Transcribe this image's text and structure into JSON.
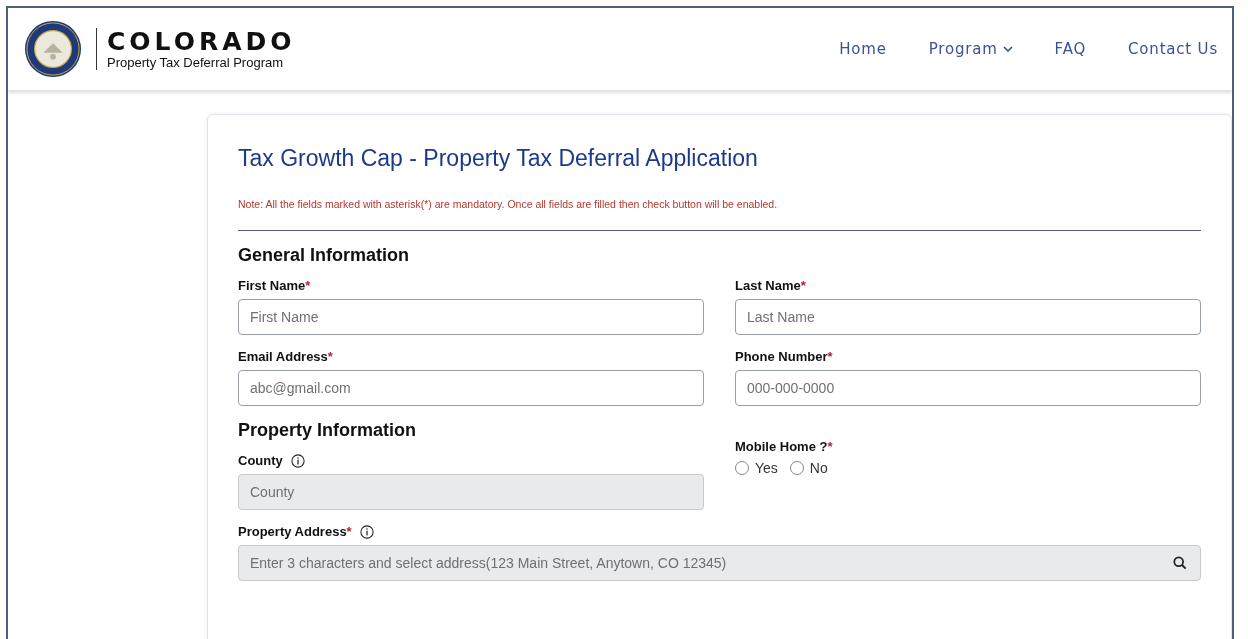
{
  "header": {
    "brand": "COLORADO",
    "subtitle": "Property Tax Deferral Program",
    "nav": [
      {
        "label": "Home",
        "dropdown": false
      },
      {
        "label": "Program",
        "dropdown": true
      },
      {
        "label": "FAQ",
        "dropdown": false
      },
      {
        "label": "Contact Us",
        "dropdown": false
      }
    ]
  },
  "form": {
    "title": "Tax Growth Cap - Property Tax Deferral Application",
    "note": "Note: All the fields marked with asterisk(*) are mandatory. Once all fields are filled then check button will be enabled.",
    "sections": [
      {
        "heading": "General Information",
        "rows": [
          [
            {
              "kind": "text",
              "label": "First Name",
              "required_mark": "*",
              "placeholder": "First Name",
              "disabled": false,
              "info": false
            },
            {
              "kind": "text",
              "label": "Last Name",
              "required_mark": "*",
              "placeholder": "Last Name",
              "disabled": false,
              "info": false
            }
          ],
          [
            {
              "kind": "text",
              "label": "Email Address",
              "required_mark": "*",
              "placeholder": "abc@gmail.com",
              "disabled": false,
              "info": false
            },
            {
              "kind": "text",
              "label": "Phone Number",
              "required_mark": "*",
              "placeholder": "000-000-0000",
              "disabled": false,
              "info": false
            }
          ]
        ]
      },
      {
        "heading": "Property Information",
        "rows": [
          [
            {
              "kind": "text",
              "label": "County",
              "placeholder": "County",
              "disabled": true,
              "info": true
            },
            {
              "kind": "radio",
              "label": "Mobile Home ?",
              "required_mark": "*",
              "options": [
                {
                  "label": "Yes",
                  "selected": false
                },
                {
                  "label": "No",
                  "selected": false
                }
              ]
            }
          ],
          [
            {
              "kind": "search",
              "label": "Property Address",
              "required_mark": "*",
              "placeholder": "Enter 3 characters and select address(123 Main Street, Anytown, CO 12345)",
              "disabled": true,
              "info": true
            }
          ]
        ]
      }
    ]
  }
}
